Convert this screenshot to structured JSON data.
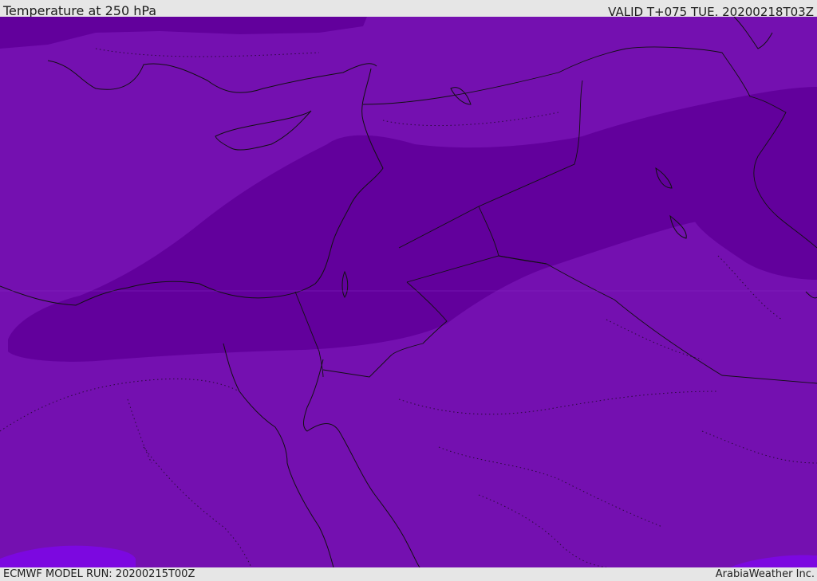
{
  "header": {
    "title": "Temperature at 250 hPa",
    "valid": "VALID T+075 TUE. 20200218T03Z"
  },
  "footer": {
    "model_run": "ECMWF MODEL RUN: 20200215T00Z",
    "credit": "ArabiaWeather Inc."
  },
  "map": {
    "colors": {
      "base": "#7410b0",
      "cold_band": "#62009c",
      "warm_patch": "#7c08e0",
      "coastline": "#111111"
    }
  }
}
